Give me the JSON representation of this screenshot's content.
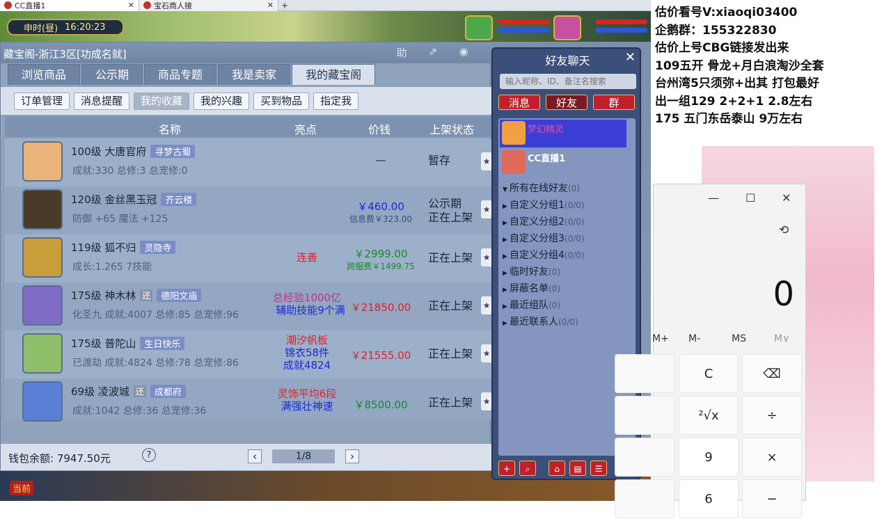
{
  "browser_tabs": [
    {
      "label": "CC直播1",
      "active": true
    },
    {
      "label": "宝石商人接",
      "active": false
    }
  ],
  "clock": {
    "period": "申时(昼)",
    "time": "16:20:23"
  },
  "store": {
    "title": "藏宝阁-浙江3区[功成名就]",
    "title_buttons": [
      "助",
      "⇗",
      "◉"
    ],
    "main_tabs": [
      "浏览商品",
      "公示期",
      "商品专题",
      "我是卖家",
      "我的藏宝阁"
    ],
    "sub_tabs": [
      "订单管理",
      "消息提醒",
      "我的收藏",
      "我的兴趣",
      "买到物品",
      "指定我"
    ],
    "columns": {
      "name": "名称",
      "highlight": "亮点",
      "price": "价钱",
      "status": "上架状态"
    },
    "rows": [
      {
        "level_name": "100级 大唐官府",
        "tag": "寻梦古蜀",
        "small_tag": "",
        "stats": "成就:330 总修:3 总宠修:0",
        "highlight": [],
        "price": "—",
        "price_sub": "",
        "status": [
          "暂存"
        ]
      },
      {
        "level_name": "120级 金丝黑玉冠",
        "tag": "齐云楼",
        "small_tag": "",
        "stats": "防御 +65 魔法 +125",
        "highlight": [],
        "price": "￥460.00",
        "price_sub": "信息费￥323.00",
        "status": [
          "公示期",
          "正在上架"
        ]
      },
      {
        "level_name": "119级 狐不归",
        "tag": "灵隐寺",
        "small_tag": "",
        "stats": "成长:1.265 7技能",
        "highlight": [
          "连善"
        ],
        "price": "￥2999.00",
        "price_sub": "跨服费￥1499.75",
        "status": [
          "正在上架"
        ]
      },
      {
        "level_name": "175级 神木林",
        "tag": "德阳文庙",
        "small_tag": "还",
        "stats": "化圣九 成就:4007 总修:85 总宠修:96",
        "highlight": [
          "总经验1000亿",
          "辅助技能9个满"
        ],
        "price": "￥21850.00",
        "price_sub": "",
        "status": [
          "正在上架"
        ]
      },
      {
        "level_name": "175级 普陀山",
        "tag": "生日快乐",
        "small_tag": "",
        "stats": "已渡劫 成就:4824 总修:78 总宠修:86",
        "highlight": [
          "潮汐帆板",
          "锦衣58件",
          "成就4824"
        ],
        "price": "￥21555.00",
        "price_sub": "",
        "status": [
          "正在上架"
        ]
      },
      {
        "level_name": "69级 凌波城",
        "tag": "成都府",
        "small_tag": "还",
        "stats": "成就:1042 总修:36 总宠修:36",
        "highlight": [
          "灵饰平均6段",
          "满强壮神速"
        ],
        "price": "￥8500.00",
        "price_sub": "",
        "status": [
          "正在上架"
        ]
      }
    ],
    "footer": {
      "balance": "钱包余额: 7947.50元",
      "help": "?",
      "page": "1/8"
    }
  },
  "chat": {
    "title": "好友聊天",
    "search_placeholder": "输入昵称、ID、备注名搜索",
    "tabs": [
      "消息",
      "好友",
      "群"
    ],
    "friends": [
      {
        "name": "梦幻精灵",
        "selected": true
      },
      {
        "name": "CC直播1",
        "selected": false
      }
    ],
    "groups": [
      {
        "label": "所有在线好友",
        "count": "(0)",
        "expanded": true
      },
      {
        "label": "自定义分组1",
        "count": "(0/0)",
        "expanded": false
      },
      {
        "label": "自定义分组2",
        "count": "(0/0)",
        "expanded": false
      },
      {
        "label": "自定义分组3",
        "count": "(0/0)",
        "expanded": false
      },
      {
        "label": "自定义分组4",
        "count": "(0/0)",
        "expanded": false
      },
      {
        "label": "临时好友",
        "count": "(0)",
        "expanded": false
      },
      {
        "label": "屏蔽名单",
        "count": "(0)",
        "expanded": false
      },
      {
        "label": "最近组队",
        "count": "(0)",
        "expanded": false
      },
      {
        "label": "最近联系人",
        "count": "(0/0)",
        "expanded": false
      }
    ]
  },
  "overlay_lines": [
    "估价看号V:xiaoqi03400",
    "企鹅群：155322830",
    "估价上号CBG链接发出来",
    "109五开 骨龙+月白浪淘沙全套",
    "台州湾5只须弥+出其 打包最好",
    "出一组129 2+2+1   2.8左右",
    "175 五门东岳泰山  9万左右"
  ],
  "calculator": {
    "display": "0",
    "memory": [
      "M+",
      "M-",
      "MS",
      "M∨"
    ],
    "keys": [
      [
        "",
        "C",
        "⌫"
      ],
      [
        "",
        "²√x",
        "÷"
      ],
      [
        "",
        "9",
        "×"
      ],
      [
        "",
        "6",
        "−"
      ]
    ]
  },
  "colors": {
    "accent_red": "#e0202a",
    "price_green": "#178a2a",
    "highlight_blue": "#1a2ad6",
    "selected_friend": "#3b3fd6"
  }
}
